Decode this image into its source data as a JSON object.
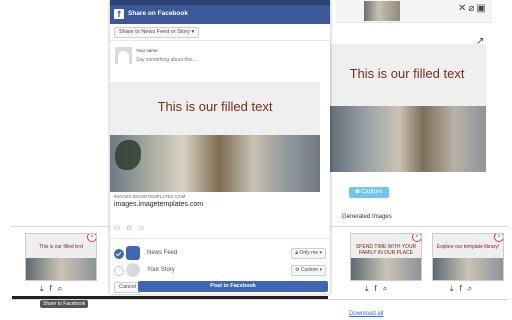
{
  "dialog": {
    "title": "Share on Facebook",
    "share_target": "Share to News Feed or Story",
    "your_name_label": "Your name",
    "composer_placeholder": "Say something about this...",
    "image_text": "This is our filled text",
    "link_domain_small": "IMAGES.IMAGETEMPLATES.COM",
    "link_domain": "images.imagetemplates.com",
    "rows": [
      {
        "label": "News Feed",
        "selected": true,
        "audience": "Only me"
      },
      {
        "label": "Your Story",
        "selected": false,
        "audience": "Custom"
      }
    ],
    "cancel_label": "Cancel",
    "post_label": "Post to Facebook"
  },
  "background": {
    "preview_text": "This is our filled text",
    "capture_label": "Capture",
    "generated_label": "Generated Images",
    "cards": [
      {
        "text": "This is our filled text"
      },
      {
        "text": ""
      },
      {
        "text": "SPEND TIME WITH YOUR FAMILY IN OUR PLACE"
      },
      {
        "text": "Explore our template library!"
      }
    ],
    "tooltip": "Share to Facebook",
    "download_all": "Download all"
  },
  "colors": {
    "facebook_blue": "#3b5998",
    "button_blue": "#4267b2",
    "capture_blue": "#6ec6ef",
    "title_text": "#7a2a1e"
  }
}
